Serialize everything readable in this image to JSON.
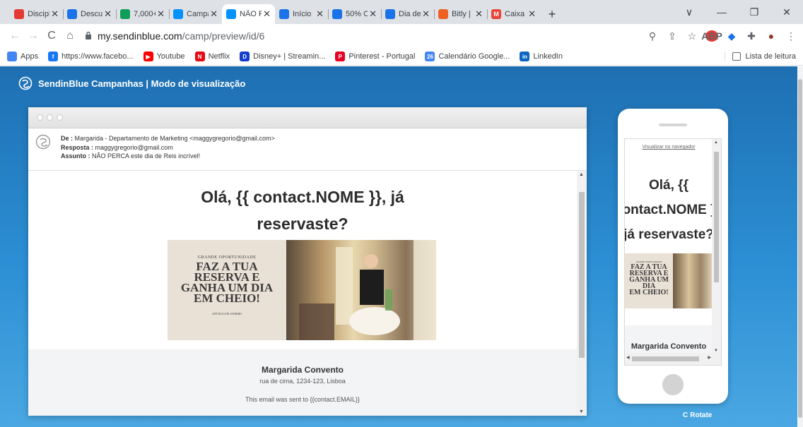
{
  "tabs": [
    {
      "title": "Discipl",
      "fav_color": "#e53935",
      "fav_glyph": ""
    },
    {
      "title": "Descul",
      "fav_color": "#1a73e8",
      "fav_glyph": ""
    },
    {
      "title": "7,000+",
      "fav_color": "#0f9d58",
      "fav_glyph": ""
    },
    {
      "title": "Campa",
      "fav_color": "#0092ff",
      "fav_glyph": ""
    },
    {
      "title": "NÃO P",
      "fav_color": "#0092ff",
      "fav_glyph": ""
    },
    {
      "title": "Início",
      "fav_color": "#1a73e8",
      "fav_glyph": ""
    },
    {
      "title": "50% O",
      "fav_color": "#1a73e8",
      "fav_glyph": ""
    },
    {
      "title": "Dia de",
      "fav_color": "#1a73e8",
      "fav_glyph": ""
    },
    {
      "title": "Bitly |",
      "fav_color": "#ee6123",
      "fav_glyph": ""
    },
    {
      "title": "Caixa",
      "fav_color": "#ea4335",
      "fav_glyph": "M"
    }
  ],
  "active_tab_index": 4,
  "window": {
    "minimize": "—",
    "maximize": "❐",
    "close": "✕",
    "new_tab": "+",
    "tab_list": "∨"
  },
  "url": {
    "host": "my.sendinblue.com",
    "path": "/camp/preview/id/6"
  },
  "toolbar_icons": {
    "back": "←",
    "forward": "→",
    "reload": "C",
    "home": "⌂",
    "lock": "🔒",
    "zoom": "⚲",
    "share": "⇪",
    "star": "☆",
    "abp": "ABP",
    "menu": "⋮"
  },
  "bookmarks": [
    {
      "label": "Apps",
      "color": "#4285f4",
      "glyph": ""
    },
    {
      "label": "https://www.facebo...",
      "color": "#1877f2",
      "glyph": "f"
    },
    {
      "label": "Youtube",
      "color": "#ff0000",
      "glyph": "▶"
    },
    {
      "label": "Netflix",
      "color": "#e50914",
      "glyph": "N"
    },
    {
      "label": "Disney+ | Streamin...",
      "color": "#113ccf",
      "glyph": "D"
    },
    {
      "label": "Pinterest - Portugal",
      "color": "#e60023",
      "glyph": "P"
    },
    {
      "label": "Calendário Google...",
      "color": "#4285f4",
      "glyph": "26"
    },
    {
      "label": "LinkedIn",
      "color": "#0a66c2",
      "glyph": "in"
    }
  ],
  "reading_list": "Lista de leitura",
  "brand": {
    "title": "SendinBlue Campanhas | Modo de visualização"
  },
  "email_header": {
    "from_label": "De :",
    "from_value": "Margarida - Departamento de Marketing <maggygregorio@gmail.com>",
    "reply_label": "Resposta :",
    "reply_value": "maggygregorio@gmail.com",
    "subject_label": "Assunto :",
    "subject_value": "NÃO PERCA este dia de Reis incrível!"
  },
  "email_body": {
    "headline_line1": "Olá, {{ contact.NOME }}, já",
    "headline_line2": "reservaste?",
    "banner": {
      "line1": "GRANDE OPORTUNIDADE",
      "line2a": "FAZ A TUA",
      "line2b": "RESERVA E",
      "line2c": "GANHA UM DIA",
      "line2d": "EM CHEIO!",
      "line3": "ATÉ DIA 6 DE JANEIRO"
    }
  },
  "email_footer": {
    "name": "Margarida Convento",
    "address": "rua de cima, 1234-123, Lisboa",
    "sent_to": "This email was sent to {{contact.EMAIL}}"
  },
  "mobile": {
    "view_in_browser": "Visualizar no navegador",
    "headline_l1": "Olá, {{",
    "headline_l2": "contact.NOME }},",
    "headline_l3": "já reservaste?",
    "banner_small": "GRANDE OPORTUNIDADE",
    "banner_l1": "FAZ A TUA",
    "banner_l2": "RESERVA E",
    "banner_l3": "GANHA UM DIA",
    "banner_l4": "EM CHEIO!",
    "footer_name": "Margarida Convento"
  },
  "rotate": {
    "icon": "C",
    "label": "Rotate"
  }
}
